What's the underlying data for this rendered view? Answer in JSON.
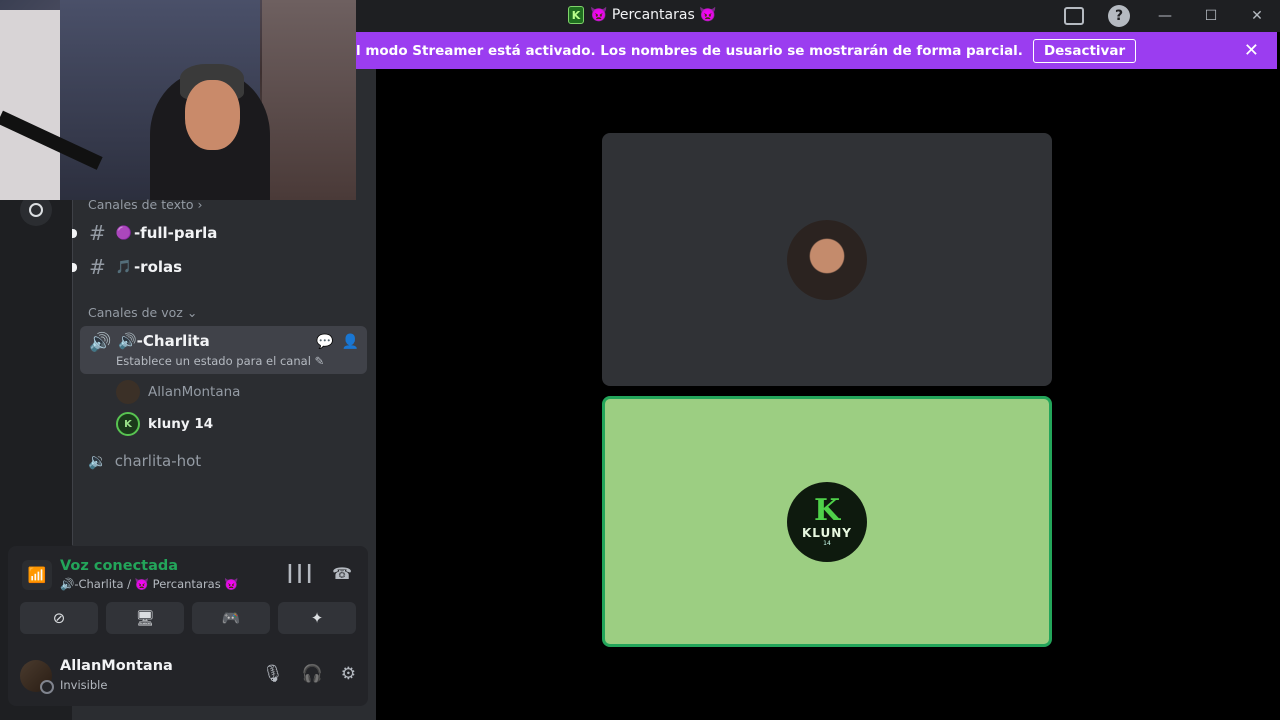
{
  "titlebar": {
    "server_logo": "K",
    "server_name": "👿 Percantaras 👿",
    "help": "?",
    "minimize": "—",
    "maximize": "☐",
    "close": "✕"
  },
  "banner": {
    "text": "l modo Streamer está activado. Los nombres de usuario se mostrarán de forma parcial.",
    "button": "Desactivar",
    "close": "✕",
    "color": "#9b3df0"
  },
  "channels": {
    "text_header": "Canales de texto",
    "text": [
      {
        "hash": "#",
        "emoji": "🟣",
        "name": "-full-parla"
      },
      {
        "hash": "#",
        "emoji": "🎵",
        "name": "-rolas"
      }
    ],
    "voice_header": "Canales de voz",
    "active_voice": {
      "name": "🔊-Charlita",
      "status": "Establece un estado para el canal ✎"
    },
    "members": [
      {
        "avatar": "",
        "name": "AllanMontana"
      },
      {
        "avatar": "K",
        "name": "kluny 14"
      }
    ],
    "other_voice": "charlita-hot"
  },
  "voice_panel": {
    "title": "Voz conectada",
    "subtitle": "🔊-Charlita / 👿 Percantaras 👿",
    "accent": "#23a55a"
  },
  "user": {
    "name": "AllanMontana",
    "status": "Invisible"
  },
  "stage": {
    "kluny_big": "K",
    "kluny_text": "KLUNY",
    "kluny_num": "14",
    "speaking_color": "#9cce82"
  }
}
